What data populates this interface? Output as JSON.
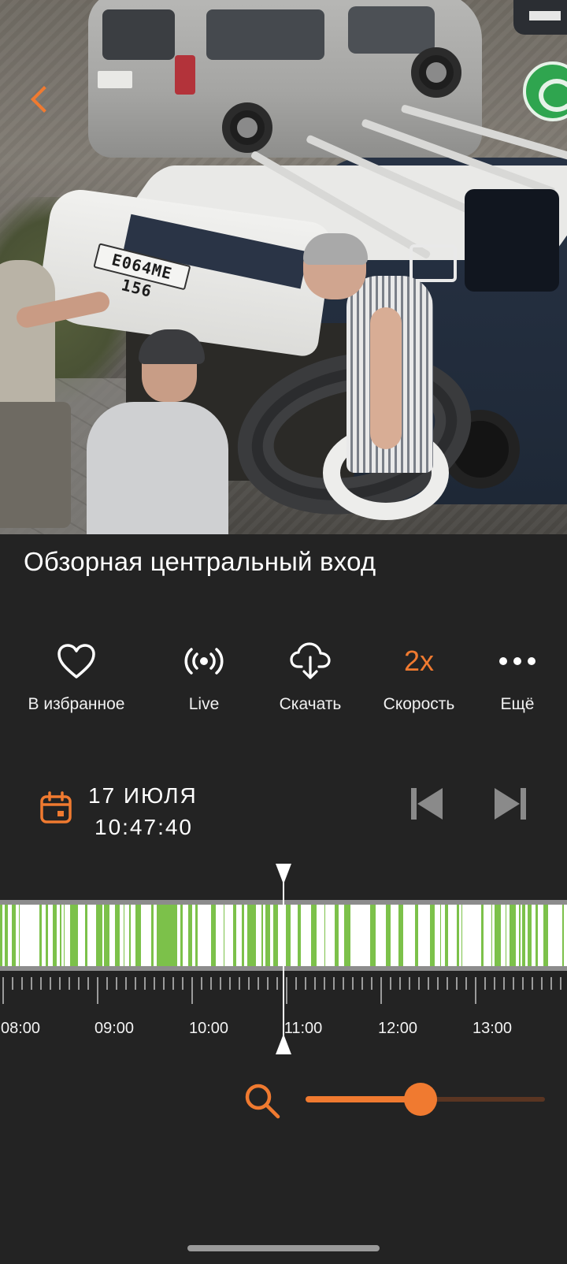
{
  "camera": {
    "title": "Обзорная центральный вход",
    "plate_text": "Е064МЕ 156"
  },
  "actions": [
    {
      "label": "В избранное",
      "icon": "heart-icon"
    },
    {
      "label": "Live",
      "icon": "broadcast-icon"
    },
    {
      "label": "Скачать",
      "icon": "cloud-download-icon"
    },
    {
      "label": "Скорость",
      "value": "2x"
    },
    {
      "label": "Ещё",
      "icon": "more-icon"
    }
  ],
  "datetime": {
    "date": "17 ИЮЛЯ",
    "time": "10:47:40"
  },
  "timeline": {
    "hour_labels": [
      "08:00",
      "09:00",
      "10:00",
      "11:00",
      "12:00",
      "13:00"
    ],
    "recording_color": "#7cc14a",
    "gap_color": "#ffffff"
  },
  "zoom": {
    "level": 0.48
  },
  "colors": {
    "accent": "#f07a30",
    "background": "#232323"
  }
}
